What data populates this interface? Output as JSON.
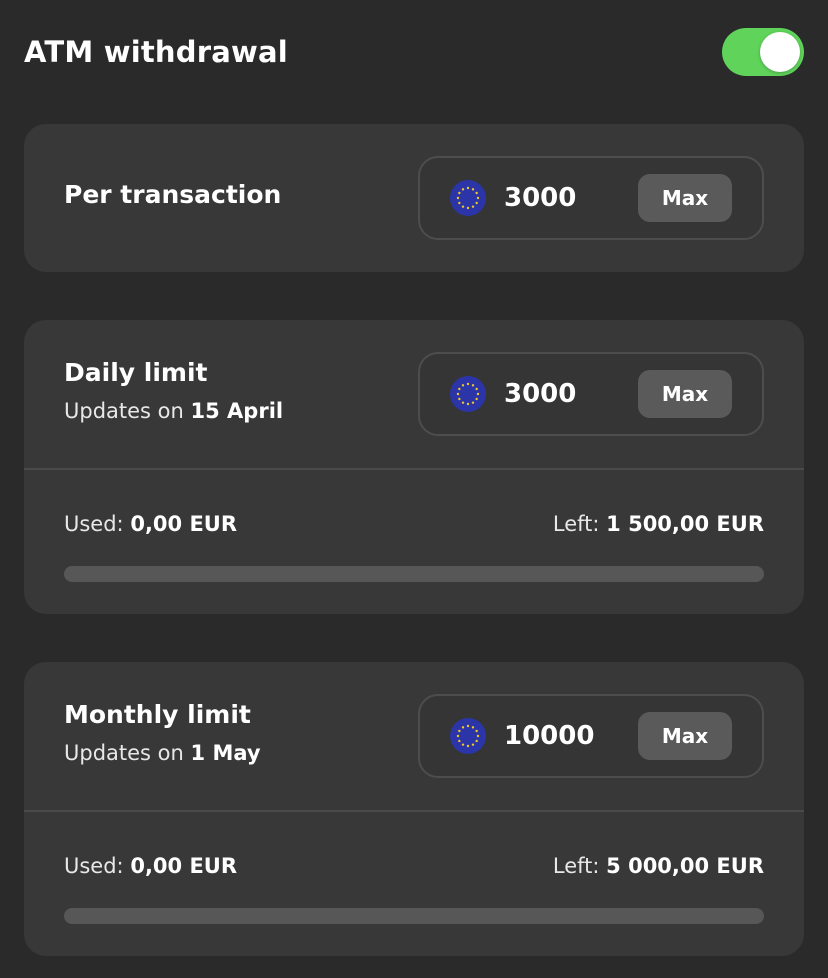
{
  "header": {
    "title": "ATM withdrawal",
    "toggle_on": true,
    "toggle_color": "#5fd35a"
  },
  "per_transaction": {
    "title": "Per transaction",
    "currency_icon": "eu-flag-icon",
    "amount": "3000",
    "max_label": "Max"
  },
  "daily_limit": {
    "title": "Daily limit",
    "updates_prefix": "Updates on",
    "updates_date": "15 April",
    "currency_icon": "eu-flag-icon",
    "amount": "3000",
    "max_label": "Max",
    "used_label": "Used:",
    "used_value": "0,00 EUR",
    "left_label": "Left:",
    "left_value": "1 500,00 EUR",
    "progress_fraction": 0
  },
  "monthly_limit": {
    "title": "Monthly limit",
    "updates_prefix": "Updates on",
    "updates_date": "1 May",
    "currency_icon": "eu-flag-icon",
    "amount": "10000",
    "max_label": "Max",
    "used_label": "Used:",
    "used_value": "0,00 EUR",
    "left_label": "Left:",
    "left_value": "5 000,00 EUR",
    "progress_fraction": 0
  },
  "colors": {
    "background": "#2a2a2a",
    "card": "#383838",
    "accent_green": "#5fd35a",
    "eu_blue": "#2b35a8",
    "eu_star": "#f3c623"
  }
}
